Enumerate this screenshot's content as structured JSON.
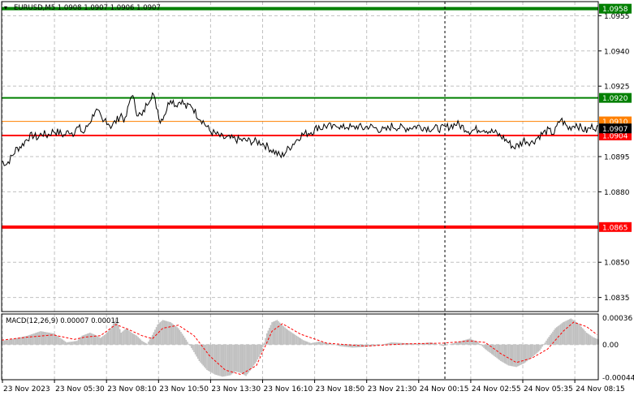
{
  "header": {
    "symbol_info": "EURUSD,M5  1.0908 1.0907 1.0906 1.0907"
  },
  "colors": {
    "background": "#ffffff",
    "grid": "#c0c0c0",
    "price_line": "#000000",
    "resistance": "#008000",
    "support": "#ff0000",
    "orange_line": "#ff8000",
    "histogram": "#c0c0c0",
    "signal": "#ff0000",
    "current_price_bg": "#000000"
  },
  "chart_data": [
    {
      "type": "line",
      "title": "EURUSD,M5  1.0908 1.0907 1.0906 1.0907",
      "y_ticks": [
        "1.0955",
        "1.0940",
        "1.0925",
        "1.0895",
        "1.0880",
        "1.0850",
        "1.0835"
      ],
      "ylim": [
        1.0829,
        1.0961
      ],
      "x_ticks": [
        "23 Nov 2023",
        "23 Nov 05:30",
        "23 Nov 08:10",
        "23 Nov 10:50",
        "23 Nov 13:30",
        "23 Nov 16:10",
        "23 Nov 18:50",
        "23 Nov 21:30",
        "24 Nov 00:15",
        "24 Nov 02:55",
        "24 Nov 05:35",
        "24 Nov 08:15"
      ],
      "grid": true,
      "horizontal_lines": [
        {
          "label": "1.0958",
          "value": 1.0958,
          "color": "#008000"
        },
        {
          "label": "1.0920",
          "value": 1.092,
          "color": "#008000"
        },
        {
          "label": "1.0910",
          "value": 1.091,
          "color": "#ff8000"
        },
        {
          "label": "1.0904",
          "value": 1.0904,
          "color": "#ff0000"
        },
        {
          "label": "1.0865",
          "value": 1.0865,
          "color": "#ff0000"
        }
      ],
      "current_price": {
        "label": "1.0907",
        "value": 1.0907
      },
      "series": [
        {
          "x_index": [
            0,
            4,
            8,
            11,
            16,
            20,
            24,
            28,
            31,
            35,
            40,
            45,
            48,
            52,
            55,
            57,
            60,
            63,
            66,
            70,
            72,
            75,
            78,
            80,
            84,
            88,
            92,
            95,
            100,
            104,
            108,
            112,
            116,
            120,
            122,
            126,
            130,
            134,
            138,
            142,
            146,
            150,
            155,
            160,
            170,
            185,
            200,
            215,
            230,
            240,
            244,
            246,
            248,
            252,
            255,
            258,
            262,
            266,
            270,
            274,
            278,
            282,
            288,
            295,
            300,
            310,
            320,
            330,
            340,
            350,
            360,
            370,
            380,
            386,
            390,
            394,
            398,
            402,
            408,
            414,
            420,
            425,
            430,
            436,
            442,
            446,
            450,
            455,
            459
          ],
          "values": [
            1.0893,
            1.0892,
            1.0895,
            1.0898,
            1.09,
            1.0903,
            1.0904,
            1.0903,
            1.0905,
            1.0904,
            1.0906,
            1.0905,
            1.0904,
            1.0906,
            1.0905,
            1.0907,
            1.0907,
            1.0905,
            1.0908,
            1.0912,
            1.0915,
            1.0913,
            1.0909,
            1.0911,
            1.0908,
            1.091,
            1.0913,
            1.091,
            1.0922,
            1.0914,
            1.0912,
            1.0918,
            1.0922,
            1.0915,
            1.091,
            1.0914,
            1.092,
            1.0917,
            1.0919,
            1.0916,
            1.0917,
            1.0913,
            1.091,
            1.0906,
            1.0903,
            1.0902,
            1.0901,
            1.0895,
            1.0904,
            1.0906,
            1.0908,
            1.0907,
            1.0908,
            1.0908,
            1.0907,
            1.0909,
            1.0907,
            1.0908,
            1.0907,
            1.0908,
            1.0907,
            1.0908,
            1.0907,
            1.0906,
            1.0908,
            1.0907,
            1.0908,
            1.0907,
            1.0907,
            1.0909,
            1.0906,
            1.0907,
            1.0905,
            1.0903,
            1.0901,
            1.0899,
            1.09,
            1.0902,
            1.0901,
            1.0904,
            1.0906,
            1.0905,
            1.0911,
            1.0907,
            1.0909,
            1.0907,
            1.0906,
            1.0908,
            1.0907
          ]
        }
      ]
    },
    {
      "type": "bar",
      "title": "MACD(12,26,9) 0.00007 0.00011",
      "y_ticks": [
        "0.00036",
        "0.00",
        "-0.00044"
      ],
      "ylim": [
        -0.00047,
        0.00041
      ],
      "series": [
        {
          "name": "MACD",
          "x_index": [
            0,
            10,
            20,
            30,
            40,
            46,
            50,
            58,
            62,
            68,
            72,
            76,
            80,
            84,
            88,
            92,
            96,
            100,
            104,
            108,
            112,
            116,
            120,
            124,
            130,
            136,
            140,
            148,
            152,
            158,
            164,
            170,
            176,
            180,
            184,
            188,
            192,
            196,
            200,
            204,
            208,
            212,
            216,
            220,
            226,
            232,
            238,
            244,
            248,
            254,
            260,
            270,
            280,
            290,
            300,
            310,
            320,
            330,
            340,
            350,
            360,
            366,
            372,
            378,
            384,
            390,
            396,
            402,
            408,
            414,
            420,
            426,
            432,
            438,
            444,
            450,
            455,
            459
          ],
          "values": [
            5e-05,
            8e-05,
            0.00012,
            0.00018,
            0.00015,
            8e-05,
            3e-05,
            5e-05,
            0.00012,
            0.00016,
            0.00013,
            9e-05,
            0.00014,
            0.00022,
            0.00035,
            0.00016,
            0.00022,
            0.00016,
            0.00012,
            5e-05,
            1e-05,
            0.00013,
            0.00027,
            0.00033,
            0.0003,
            0.00022,
            0.00012,
            -0.0001,
            -0.00022,
            -0.00034,
            -0.0004,
            -0.00043,
            -0.00041,
            -0.00036,
            -0.00038,
            -0.00042,
            -0.00033,
            -0.00023,
            -0.0001,
            0.00015,
            0.0003,
            0.00033,
            0.00026,
            0.0002,
            0.00013,
            6e-05,
            2e-05,
            4e-05,
            3e-05,
            1e-05,
            -2e-05,
            -4e-05,
            -3e-05,
            -1e-05,
            3e-05,
            2e-05,
            1e-05,
            3e-05,
            -2e-05,
            3e-05,
            8e-05,
            4e-05,
            -6e-05,
            -0.00014,
            -0.00022,
            -0.00028,
            -0.0003,
            -0.00025,
            -0.00017,
            -8e-05,
            8e-05,
            0.00022,
            0.0003,
            0.00035,
            0.00028,
            0.00016,
            0.0001,
            7e-05
          ]
        },
        {
          "name": "Signal",
          "x_index": [
            0,
            20,
            40,
            56,
            64,
            76,
            88,
            98,
            108,
            116,
            124,
            136,
            148,
            160,
            172,
            184,
            196,
            208,
            216,
            230,
            250,
            280,
            310,
            340,
            360,
            372,
            384,
            396,
            408,
            420,
            432,
            440,
            450,
            459
          ],
          "values": [
            6e-05,
            0.0001,
            0.00013,
            7e-05,
            0.0001,
            0.00012,
            0.00027,
            0.0002,
            0.00012,
            8e-05,
            0.00022,
            0.00026,
            0.00012,
            -0.00015,
            -0.00034,
            -0.0004,
            -0.00028,
            0.00018,
            0.00028,
            0.00014,
            2e-05,
            -2e-05,
            1e-05,
            2e-05,
            5e-05,
            3e-05,
            -0.00012,
            -0.00024,
            -0.00018,
            -6e-05,
            0.00018,
            0.0003,
            0.00024,
            0.00012
          ]
        }
      ]
    }
  ]
}
